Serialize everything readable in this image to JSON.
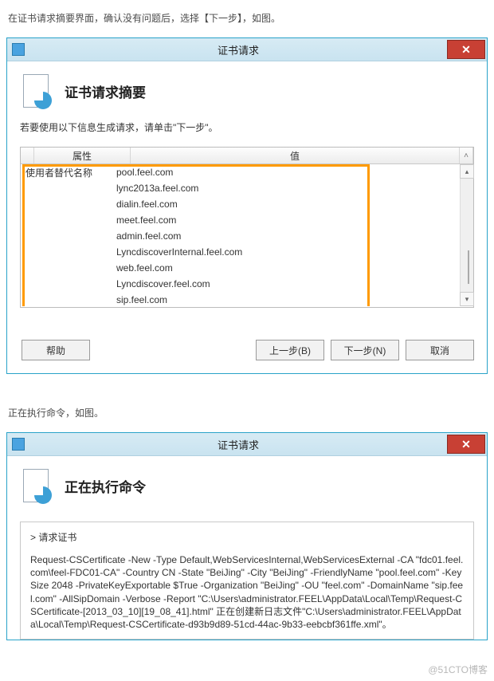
{
  "intro1": "在证书请求摘要界面，确认没有问题后，选择【下一步】，如图。",
  "dialog1": {
    "title": "证书请求",
    "heading": "证书请求摘要",
    "instruction": "若要使用以下信息生成请求，请单击\"下一步\"。",
    "columns": {
      "attr": "属性",
      "value": "值"
    },
    "rows": [
      {
        "attr": "使用者替代名称",
        "value": "pool.feel.com"
      },
      {
        "attr": "",
        "value": "lync2013a.feel.com"
      },
      {
        "attr": "",
        "value": "dialin.feel.com"
      },
      {
        "attr": "",
        "value": "meet.feel.com"
      },
      {
        "attr": "",
        "value": "admin.feel.com"
      },
      {
        "attr": "",
        "value": "LyncdiscoverInternal.feel.com"
      },
      {
        "attr": "",
        "value": "web.feel.com"
      },
      {
        "attr": "",
        "value": "Lyncdiscover.feel.com"
      },
      {
        "attr": "",
        "value": "sip.feel.com"
      }
    ],
    "buttons": {
      "help": "帮助",
      "back": "上一步(B)",
      "next": "下一步(N)",
      "cancel": "取消"
    }
  },
  "intro2": "正在执行命令，如图。",
  "dialog2": {
    "title": "证书请求",
    "heading": "正在执行命令",
    "task_title": "请求证书",
    "command": "Request-CSCertificate -New -Type Default,WebServicesInternal,WebServicesExternal -CA \"fdc01.feel.com\\feel-FDC01-CA\" -Country CN -State \"BeiJing\" -City \"BeiJing\" -FriendlyName \"pool.feel.com\" -KeySize 2048 -PrivateKeyExportable $True -Organization \"BeiJing\" -OU \"feel.com\" -DomainName \"sip.feel.com\" -AllSipDomain -Verbose -Report \"C:\\Users\\administrator.FEEL\\AppData\\Local\\Temp\\Request-CSCertificate-[2013_03_10][19_08_41].html\" 正在创建新日志文件\"C:\\Users\\administrator.FEEL\\AppData\\Local\\Temp\\Request-CSCertificate-d93b9d89-51cd-44ac-9b33-eebcbf361ffe.xml\"。"
  },
  "watermark": "@51CTO博客"
}
